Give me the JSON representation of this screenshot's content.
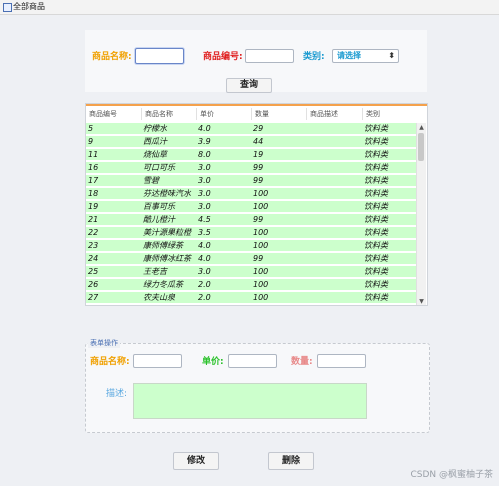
{
  "window": {
    "title": "全部商品"
  },
  "search": {
    "name_label": "商品名称:",
    "code_label": "商品编号:",
    "category_label": "类别:",
    "category_value": "请选择",
    "query_button": "查询"
  },
  "table": {
    "headers": [
      "商品编号",
      "商品名称",
      "单价",
      "数量",
      "商品描述",
      "类别"
    ],
    "rows": [
      [
        "5",
        "柠檬水",
        "4.0",
        "29",
        "",
        "饮料类"
      ],
      [
        "9",
        "西瓜汁",
        "3.9",
        "44",
        "",
        "饮料类"
      ],
      [
        "11",
        "烧仙草",
        "8.0",
        "19",
        "",
        "饮料类"
      ],
      [
        "16",
        "可口可乐",
        "3.0",
        "99",
        "",
        "饮料类"
      ],
      [
        "17",
        "雪碧",
        "3.0",
        "99",
        "",
        "饮料类"
      ],
      [
        "18",
        "芬达橙味汽水",
        "3.0",
        "100",
        "",
        "饮料类"
      ],
      [
        "19",
        "百事可乐",
        "3.0",
        "100",
        "",
        "饮料类"
      ],
      [
        "21",
        "酷儿橙汁",
        "4.5",
        "99",
        "",
        "饮料类"
      ],
      [
        "22",
        "美汁源果粒橙",
        "3.5",
        "100",
        "",
        "饮料类"
      ],
      [
        "23",
        "康师傅绿茶",
        "4.0",
        "100",
        "",
        "饮料类"
      ],
      [
        "24",
        "康师傅冰红茶",
        "4.0",
        "99",
        "",
        "饮料类"
      ],
      [
        "25",
        "王老吉",
        "3.0",
        "100",
        "",
        "饮料类"
      ],
      [
        "26",
        "绿力冬瓜茶",
        "2.0",
        "100",
        "",
        "饮料类"
      ],
      [
        "27",
        "农夫山泉",
        "2.0",
        "100",
        "",
        "饮料类"
      ]
    ]
  },
  "form": {
    "legend": "表单操作",
    "name_label": "商品名称:",
    "price_label": "单价:",
    "qty_label": "数量:",
    "desc_label": "描述:"
  },
  "buttons": {
    "modify": "修改",
    "delete": "删除"
  },
  "watermark": "CSDN @枫蜜柚子茶"
}
